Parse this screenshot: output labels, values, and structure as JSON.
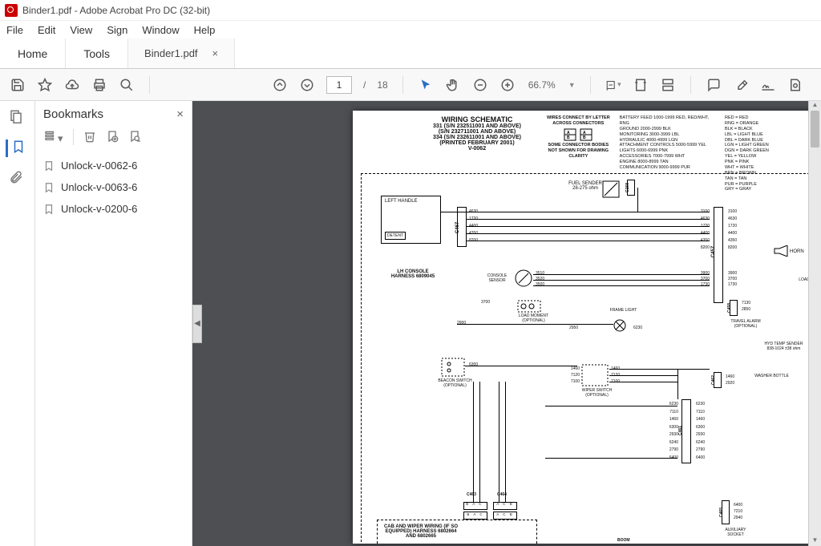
{
  "window": {
    "title": "Binder1.pdf - Adobe Acrobat Pro DC (32-bit)"
  },
  "menu": {
    "file": "File",
    "edit": "Edit",
    "view": "View",
    "sign": "Sign",
    "window": "Window",
    "help": "Help"
  },
  "tabs": {
    "home": "Home",
    "tools": "Tools",
    "doc": "Binder1.pdf"
  },
  "toolbar": {
    "page_current": "1",
    "page_sep": "/",
    "page_total": "18",
    "zoom": "66.7%"
  },
  "bookmarks": {
    "title": "Bookmarks",
    "items": [
      {
        "label": "Unlock-v-0062-6"
      },
      {
        "label": "Unlock-v-0063-6"
      },
      {
        "label": "Unlock-v-0200-6"
      }
    ]
  },
  "schematic": {
    "title": "WIRING SCHEMATIC",
    "lines": [
      "331 (S/N 232511001 AND ABOVE)",
      "(S/N 232711001 AND ABOVE)",
      "334 (S/N 232611001 AND ABOVE)",
      "(PRINTED FEBRUARY 2001)",
      "V-0062"
    ],
    "note_top": "WIRES CONNECT BY LETTER ACROSS CONNECTORS",
    "note_mid": "SOME CONNECTOR BODIES NOT SHOWN FOR DRAWING CLARITY",
    "legend_left": [
      "BATTERY FEED 1000-1999 RED, RED/WHT, RNG",
      "GROUND 2000-2999 BLK",
      "MONITORING 3000-3999 LBL",
      "HYDRAULIC 4000-4999 LGN",
      "ATTACHMENT CONTROLS 5000-5999 YEL",
      "LIGHTS 6000-6999 PNK",
      "ACCESSORIES 7000-7999 WHT",
      "ENGINE 8000-8999 TAN",
      "COMMUNICATION 9000-9999 PUR"
    ],
    "legend_right": [
      "RED = RED",
      "RNG = ORANGE",
      "BLK = BLACK",
      "LBL = LIGHT BLUE",
      "DBL = DARK BLUE",
      "LGN = LIGHT GREEN",
      "DGN = DARK GREEN",
      "YEL = YELLOW",
      "PNK = PINK",
      "WHT = WHITE",
      "BRN = BROWN",
      "TAN = TAN",
      "PUR = PURPLE",
      "GRY = GRAY"
    ],
    "blocks": {
      "left_handle": "LEFT HANDLE",
      "detent": "DETENT",
      "lh_console": "LH CONSOLE HARNESS 6809045",
      "console_sensor": "CONSOLE SENSOR",
      "fuel_sender": "FUEL SENDER 28-275 ohm",
      "load_moment": "LOAD MOMENT (OPTIONAL)",
      "frame_light": "FRAME LIGHT",
      "beacon": "BEACON SWITCH (OPTIONAL)",
      "wiper": "WIPER SWITCH (OPTIONAL)",
      "cab": "CAB AND WIPER WIRING (IF SO EQUIPPED) HARNESS 6802664 AND 6802665",
      "horn": "HORN",
      "travel_alarm": "TRAVEL ALARM (OPTIONAL)",
      "hyd_temp": "HYD TEMP SENDER 838-1024 ±38 ohm",
      "washer": "WASHER BOTTLE",
      "aux_socket": "AUXILIARY SOCKET",
      "boom": "BOOM",
      "load_m": "LOAD M (OPTIC"
    },
    "connectors": [
      "C158",
      "C467",
      "C457",
      "C458",
      "C462",
      "C461",
      "C463",
      "C464",
      "C465"
    ],
    "wire_nums": {
      "left_block": [
        "4630",
        "1720",
        "4400",
        "4350",
        "8200"
      ],
      "mid_block": [
        "3100",
        "4630",
        "1720",
        "4400",
        "4350",
        "8200"
      ],
      "right_block": [
        "3100",
        "4630",
        "1720",
        "4400",
        "4350",
        "8200"
      ],
      "sensor": [
        "3510",
        "3520",
        "3500"
      ],
      "sensor2": [
        "3900",
        "3700",
        "1730"
      ],
      "c458": [
        "7130",
        "2850"
      ],
      "below": [
        "3700",
        "2900",
        "2950",
        "6230"
      ],
      "beacon": [
        "6300"
      ],
      "wiper_l": [
        "1460",
        "7120",
        "7100"
      ],
      "wiper_r": [
        "1460",
        "7120",
        "7100"
      ],
      "c461_l": [
        "6230",
        "7110",
        "1460",
        "6300",
        "2930",
        "6240",
        "2790",
        "6400"
      ],
      "c461_r": [
        "6230",
        "7110",
        "1460",
        "6300",
        "2930",
        "6240",
        "2790",
        "6400"
      ],
      "c462": [
        "1460",
        "2920"
      ],
      "c465": [
        "6400",
        "7210",
        "2940"
      ],
      "horn": [
        "3900",
        "3700",
        "1730"
      ]
    }
  }
}
